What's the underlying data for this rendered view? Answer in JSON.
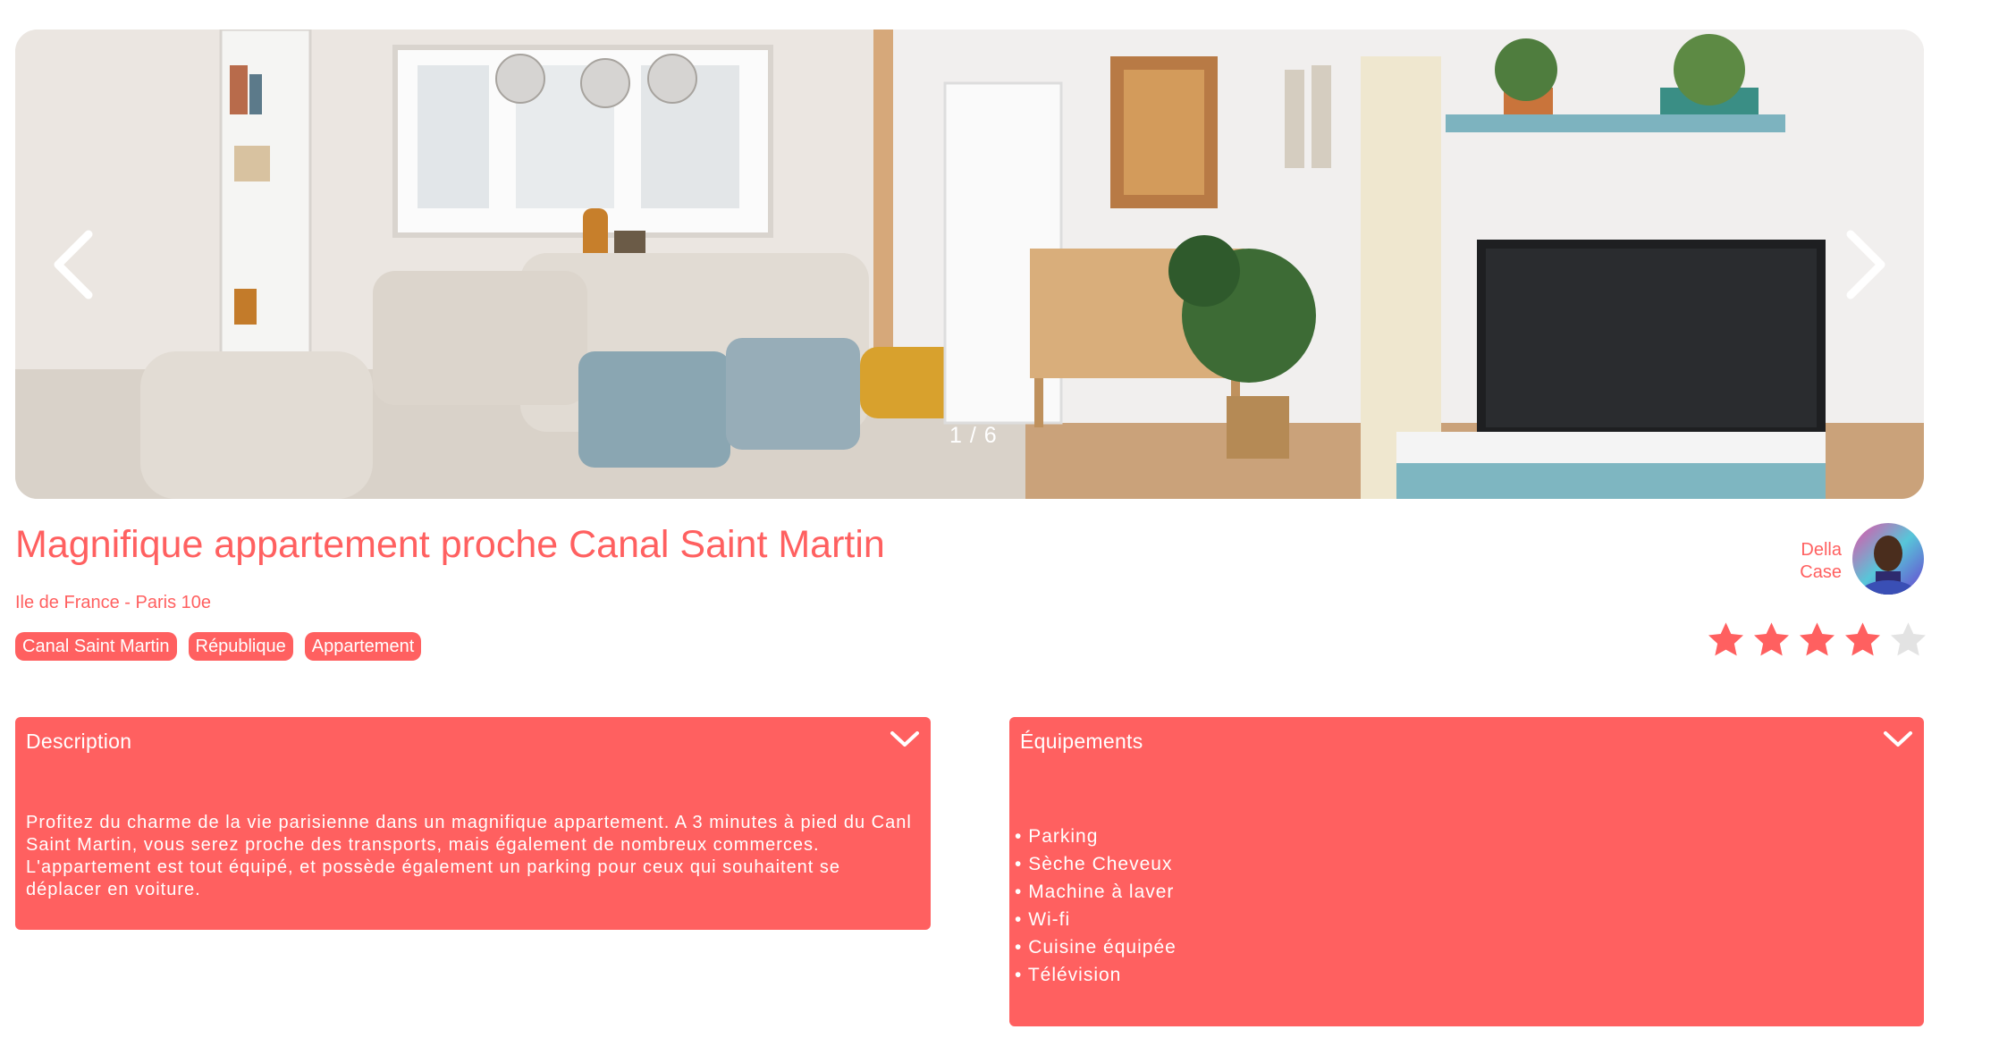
{
  "gallery": {
    "counter": "1 / 6",
    "prev_icon": "chevron-left-icon",
    "next_icon": "chevron-right-icon"
  },
  "listing": {
    "title": "Magnifique appartement proche Canal Saint Martin",
    "location": "Ile de France - Paris 10e",
    "tags": [
      "Canal Saint Martin",
      "République",
      "Appartement"
    ],
    "rating": 4,
    "rating_max": 5
  },
  "host": {
    "first_name": "Della",
    "last_name": "Case"
  },
  "description": {
    "header": "Description",
    "text": "Profitez du charme de la vie parisienne dans un magnifique appartement. A 3 minutes à pied du Canl Saint Martin, vous serez proche des transports, mais également de nombreux commerces. L'appartement est tout équipé, et possède également un parking pour ceux qui souhaitent se déplacer en voiture."
  },
  "equipments": {
    "header": "Équipements",
    "items": [
      "Parking",
      "Sèche Cheveux",
      "Machine à laver",
      "Wi-fi",
      "Cuisine équipée",
      "Télévision"
    ]
  },
  "colors": {
    "accent": "#ff6060",
    "star_empty": "#e3e3e3"
  }
}
